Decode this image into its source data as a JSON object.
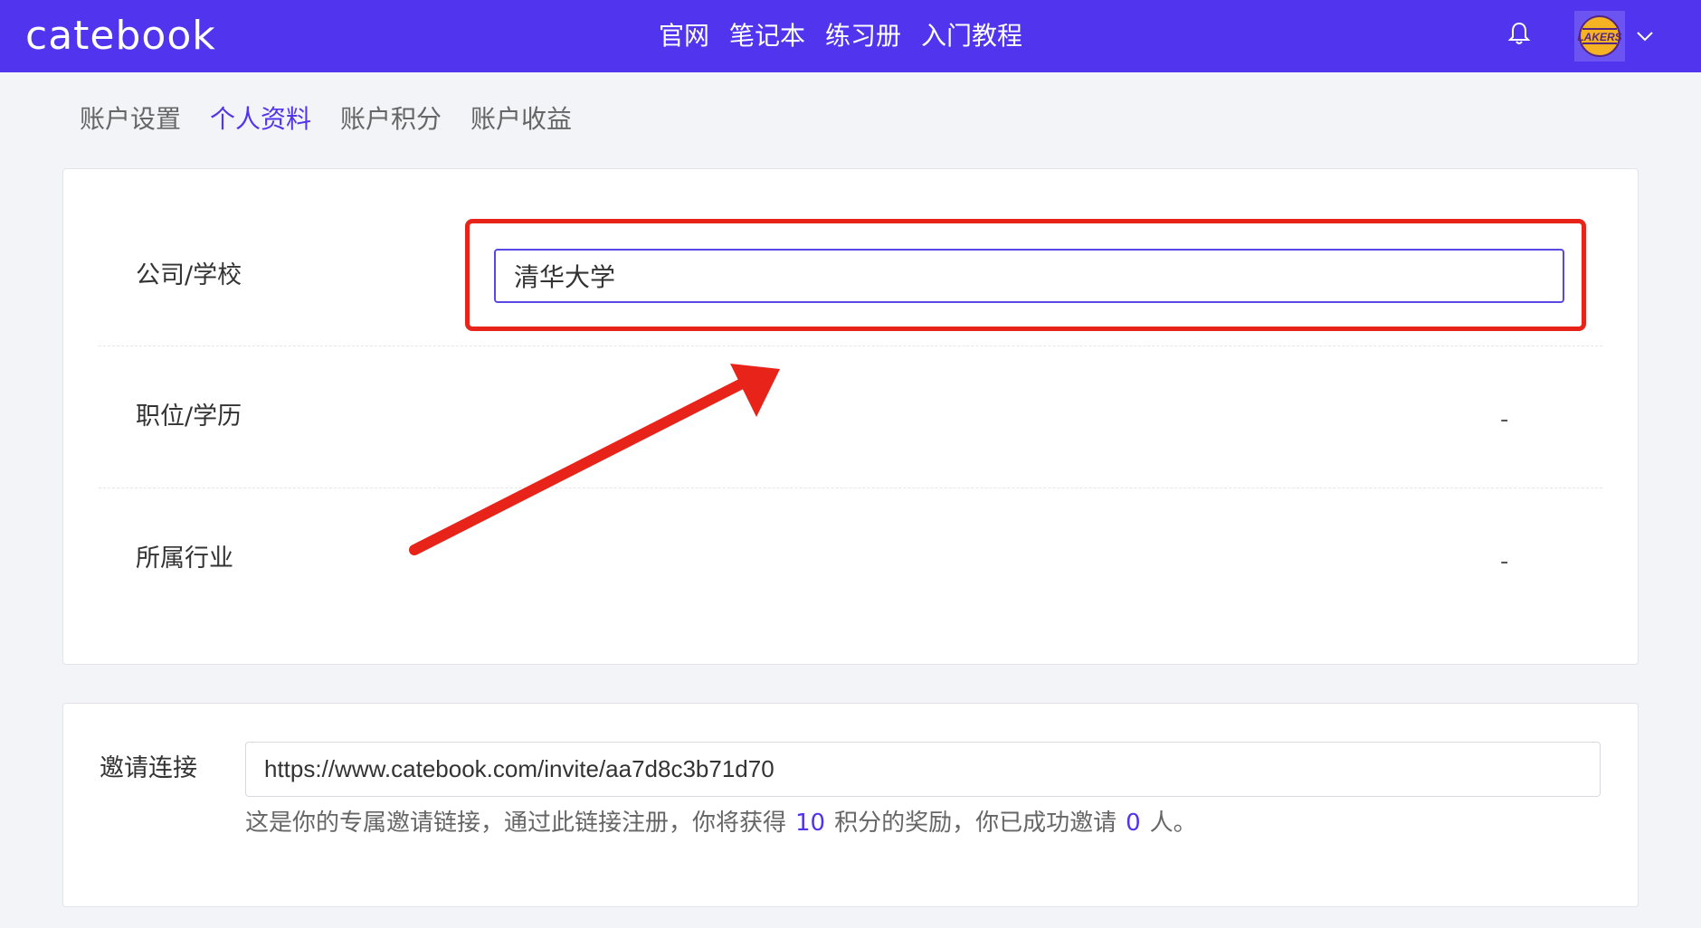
{
  "header": {
    "logo": "catebook",
    "nav": [
      "官网",
      "笔记本",
      "练习册",
      "入门教程"
    ],
    "bell_icon": "bell-icon",
    "avatar_icon": "lakers-avatar",
    "avatar_text": "LAKERS",
    "chevron_icon": "chevron-down-icon",
    "brand_color": "#5034ee"
  },
  "tabs": {
    "items": [
      "账户设置",
      "个人资料",
      "账户积分",
      "账户收益"
    ],
    "active": "个人资料"
  },
  "profile": {
    "company_label": "公司/学校",
    "company_value": "清华大学",
    "position_label": "职位/学历",
    "position_value": "-",
    "industry_label": "所属行业",
    "industry_value": "-"
  },
  "invite": {
    "label": "邀请连接",
    "link": "https://www.catebook.com/invite/aa7d8c3b71d70",
    "note_prefix": "这是你的专属邀请链接，通过此链接注册，你将获得",
    "points": "10",
    "note_middle": "积分的奖励，你已成功邀请",
    "count": "0",
    "note_suffix": "人。"
  },
  "annotation": {
    "highlight_color": "#e8241a"
  }
}
